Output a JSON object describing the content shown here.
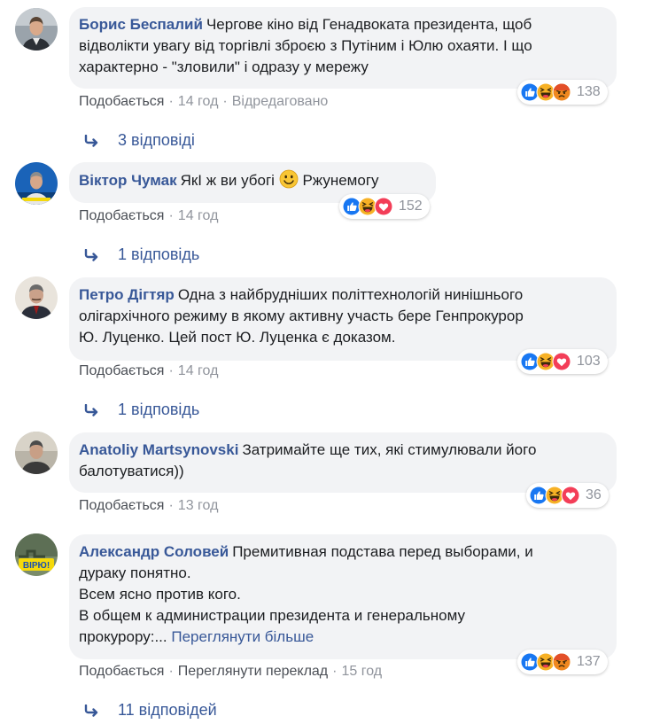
{
  "comments": [
    {
      "author": "Борис Беспалий",
      "lines": [
        "Чергове кіно від Генадвоката президента, щоб",
        "відволікти увагу від торгівлі зброєю з Путіним і Юлю охаяти. І що",
        "характерно - \"зловили\" і одразу у мережу"
      ],
      "like_label": "Подобається",
      "time": "14 год",
      "edited_label": "Відредаговано",
      "reaction_count": "138",
      "reactions": [
        "like-icon",
        "haha-icon",
        "angry-icon"
      ],
      "replies_label": "3 відповіді"
    },
    {
      "author": "Віктор Чумак",
      "text_before": "ЯкІ ж ви убогі",
      "text_after": "Ржунемогу",
      "emoji": "smile-emoji-icon",
      "like_label": "Подобається",
      "time": "14 год",
      "reaction_count": "152",
      "reactions": [
        "like-icon",
        "haha-icon",
        "love-icon"
      ],
      "replies_label": "1 відповідь"
    },
    {
      "author": "Петро Дігтяр",
      "lines": [
        "Одна з найбрудніших політтехнологій нинішнього",
        "олігархічного режиму в якому активну участь бере Генпрокурор",
        "Ю. Луценко. Цей пост Ю. Луценка є доказом."
      ],
      "like_label": "Подобається",
      "time": "14 год",
      "reaction_count": "103",
      "reactions": [
        "like-icon",
        "haha-icon",
        "love-icon"
      ],
      "replies_label": "1 відповідь"
    },
    {
      "author": "Anatoliy Martsynovski",
      "lines": [
        "Затримайте ще тих, які стимулювали його",
        "балотуватися))"
      ],
      "like_label": "Подобається",
      "time": "13 год",
      "reaction_count": "36",
      "reactions": [
        "like-icon",
        "haha-icon",
        "love-icon"
      ]
    },
    {
      "author": "Александр Соловей",
      "lines": [
        "Премитивная подстава перед выборами, и",
        "дураку понятно.",
        "Всем ясно против кого.",
        "В общем к администрации президента и генеральному",
        "прокурору:..."
      ],
      "see_more": "Переглянути більше",
      "like_label": "Подобається",
      "translate_label": "Переглянути переклад",
      "time": "15 год",
      "reaction_count": "137",
      "reactions": [
        "like-icon",
        "haha-icon",
        "angry-icon"
      ],
      "replies_label": "11 відповідей",
      "avatar_text": "ВІРЮ!"
    }
  ],
  "colors": {
    "link": "#385898",
    "bubble": "#f2f3f5",
    "meta": "#90949c",
    "like": "#1877f2",
    "haha": "#f7b125",
    "love": "#f33e58",
    "angry": "#e9710f"
  }
}
